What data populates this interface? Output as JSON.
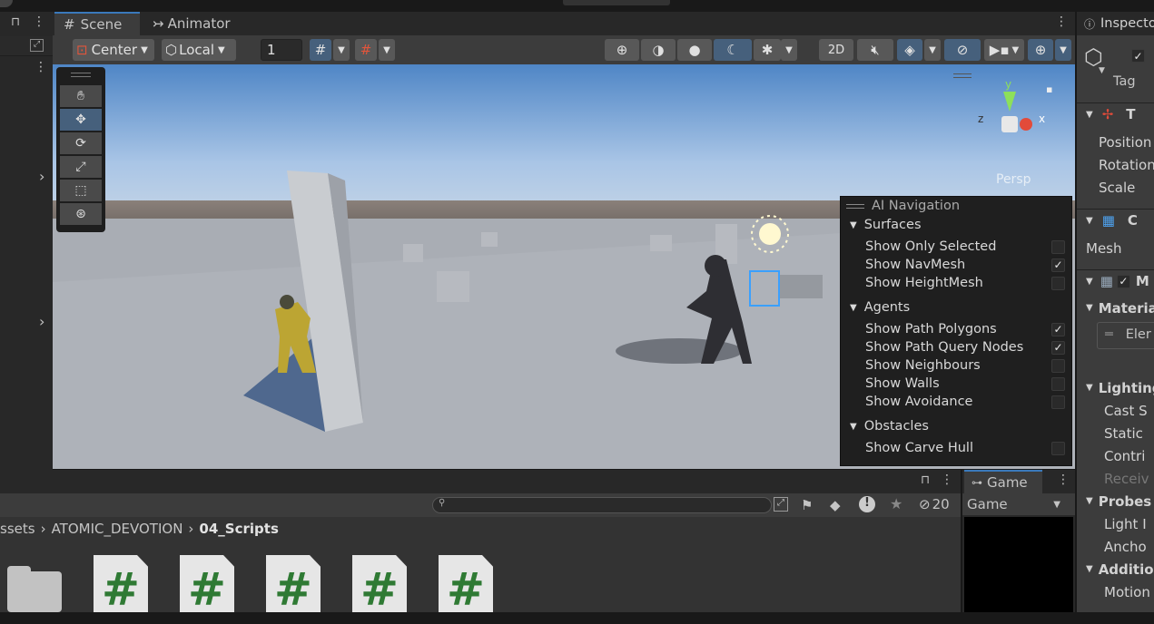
{
  "tabs": {
    "scene": "Scene",
    "animator": "Animator",
    "inspector": "Inspector",
    "game": "Game"
  },
  "toolbar": {
    "pivot": "Center",
    "space": "Local",
    "grid_value": "1",
    "mode_2d": "2D"
  },
  "gizmo": {
    "y": "y",
    "x": "x",
    "z": "z",
    "projection": "Persp"
  },
  "ai_navigation": {
    "title": "AI Navigation",
    "sections": [
      {
        "name": "Surfaces",
        "items": [
          {
            "label": "Show Only Selected",
            "checked": false
          },
          {
            "label": "Show NavMesh",
            "checked": true
          },
          {
            "label": "Show HeightMesh",
            "checked": false
          }
        ]
      },
      {
        "name": "Agents",
        "items": [
          {
            "label": "Show Path Polygons",
            "checked": true
          },
          {
            "label": "Show Path Query Nodes",
            "checked": true
          },
          {
            "label": "Show Neighbours",
            "checked": false
          },
          {
            "label": "Show Walls",
            "checked": false
          },
          {
            "label": "Show Avoidance",
            "checked": false
          }
        ]
      },
      {
        "name": "Obstacles",
        "items": [
          {
            "label": "Show Carve Hull",
            "checked": false
          }
        ]
      }
    ]
  },
  "inspector": {
    "tag_label": "Tag",
    "transform": "T",
    "position": "Position",
    "rotation": "Rotation",
    "scale": "Scale",
    "mesh_filter": "C",
    "mesh": "Mesh",
    "mesh_renderer": "M",
    "materials": "Materia",
    "element": "Eler",
    "lighting": "Lighting",
    "cast": "Cast S",
    "static": "Static",
    "contrib": "Contri",
    "receive": "Receiv",
    "probes": "Probes",
    "light": "Light I",
    "anchor": "Ancho",
    "additional": "Additio",
    "motion": "Motion"
  },
  "project": {
    "breadcrumb": [
      "ssets",
      "ATOMIC_DEVOTION",
      "04_Scripts"
    ],
    "hidden_count": "20",
    "file_glyph": "#"
  },
  "game": {
    "display": "Game"
  },
  "colors": {
    "accent": "#3a79bb",
    "selected": "#46607c",
    "script_green": "#2f7a34"
  }
}
